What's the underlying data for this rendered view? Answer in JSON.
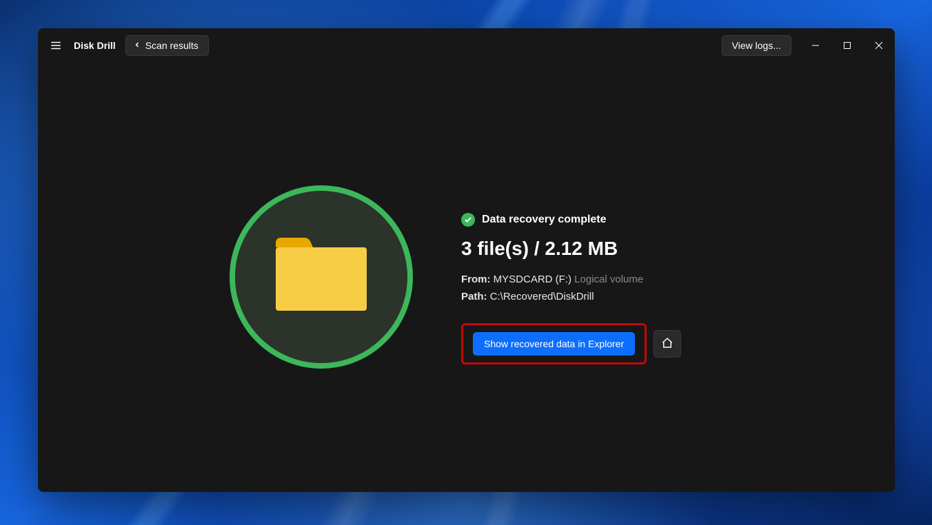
{
  "header": {
    "title": "Disk Drill",
    "back_label": "Scan results",
    "logs_label": "View logs..."
  },
  "recovery": {
    "status": "Data recovery complete",
    "summary": "3 file(s) / 2.12 MB",
    "from_label": "From:",
    "from_value": "MYSDCARD (F:)",
    "from_type": "Logical volume",
    "path_label": "Path:",
    "path_value": "C:\\Recovered\\DiskDrill",
    "action_label": "Show recovered data in Explorer"
  }
}
